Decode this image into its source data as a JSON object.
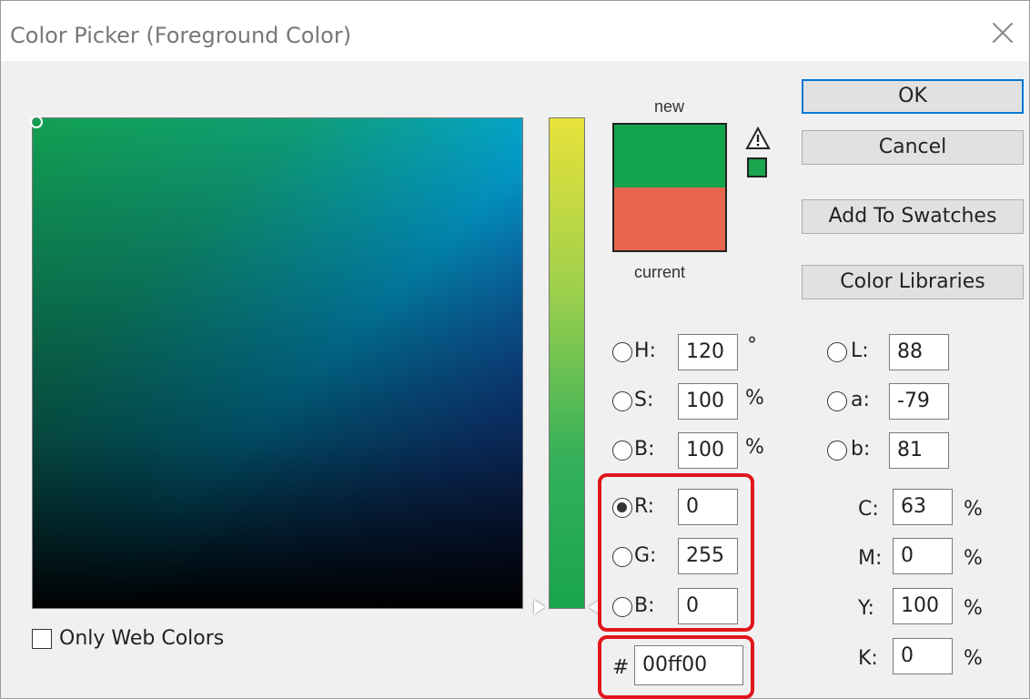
{
  "window": {
    "title": "Color Picker (Foreground Color)"
  },
  "preview": {
    "new_label": "new",
    "current_label": "current",
    "new_color": "#14a44d",
    "current_color": "#e8654e",
    "websafe_color": "#19a54d"
  },
  "buttons": {
    "ok": "OK",
    "cancel": "Cancel",
    "add_to_swatches": "Add To Swatches",
    "color_libraries": "Color Libraries"
  },
  "hsb": [
    {
      "label": "H:",
      "value": "120",
      "unit": "°",
      "selected": false
    },
    {
      "label": "S:",
      "value": "100",
      "unit": "%",
      "selected": false
    },
    {
      "label": "B:",
      "value": "100",
      "unit": "%",
      "selected": false
    }
  ],
  "rgb": [
    {
      "label": "R:",
      "value": "0",
      "selected": true
    },
    {
      "label": "G:",
      "value": "255",
      "selected": false
    },
    {
      "label": "B:",
      "value": "0",
      "selected": false
    }
  ],
  "lab": [
    {
      "label": "L:",
      "value": "88",
      "selected": false
    },
    {
      "label": "a:",
      "value": "-79",
      "selected": false
    },
    {
      "label": "b:",
      "value": "81",
      "selected": false
    }
  ],
  "cmyk": [
    {
      "label": "C:",
      "value": "63",
      "unit": "%"
    },
    {
      "label": "M:",
      "value": "0",
      "unit": "%"
    },
    {
      "label": "Y:",
      "value": "100",
      "unit": "%"
    },
    {
      "label": "K:",
      "value": "0",
      "unit": "%"
    }
  ],
  "hex": {
    "label": "#",
    "value": "00ff00"
  },
  "only_web_colors": {
    "label": "Only Web Colors",
    "checked": false
  },
  "colors": {
    "highlight": "#e0161c",
    "default_button_border": "#0078d7"
  }
}
